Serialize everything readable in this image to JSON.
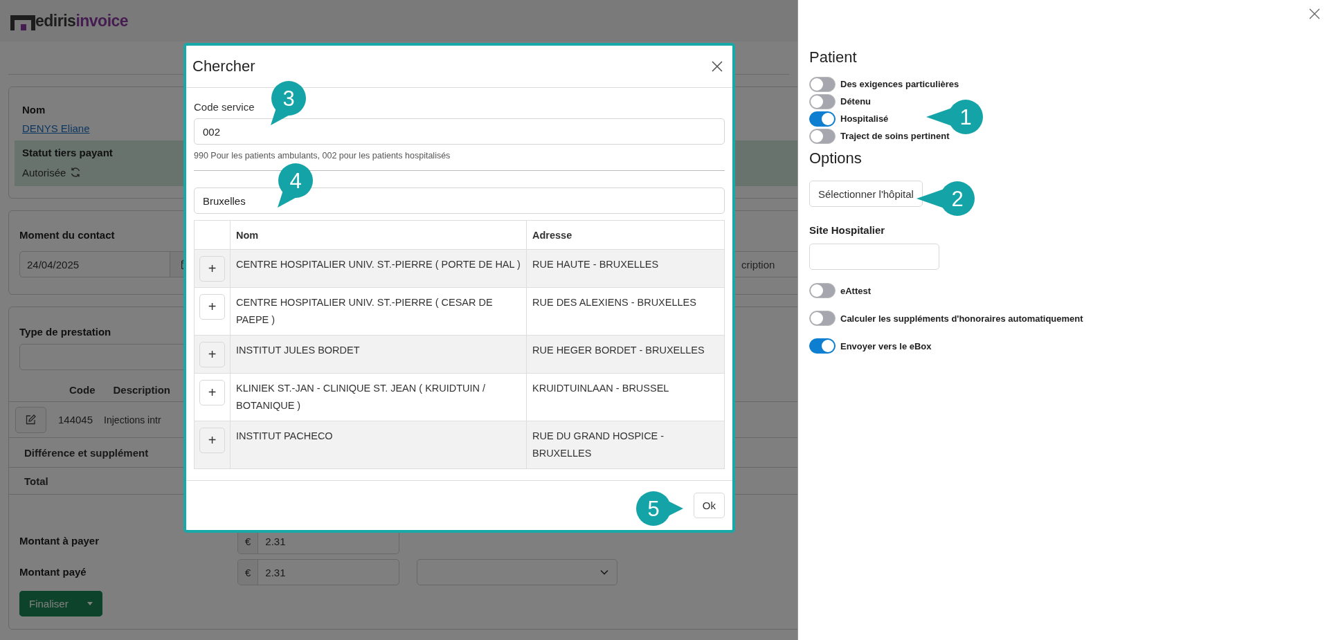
{
  "logo": {
    "brand": "ediris",
    "product": "invoice"
  },
  "patient_card": {
    "name_label": "Nom",
    "name": "DENYS Eliane",
    "status_label": "Statut tiers payant",
    "status": "Autorisée"
  },
  "contact_card": {
    "label": "Moment du contact",
    "date": "24/04/2025",
    "field_2_text": "cription"
  },
  "service_card": {
    "label": "Type de prestation",
    "columns": [
      "Code",
      "Description"
    ],
    "rows": [
      {
        "code": "144045",
        "description": "Injections intr"
      }
    ],
    "difference_label": "Différence et supplément",
    "total_label": "Total"
  },
  "payment": {
    "due_label": "Montant à payer",
    "due_currency": "€",
    "due_amount": "2.31",
    "paid_label": "Montant payé",
    "paid_currency": "€",
    "paid_amount": "2.31",
    "finalize_button": "Finaliser"
  },
  "modal": {
    "title": "Chercher",
    "service_code_label": "Code service",
    "service_code": "002",
    "hint": "990 Pour les patients ambulants, 002 pour les patients hospitalisés",
    "search": "Bruxelles",
    "columns": [
      "Nom",
      "Adresse"
    ],
    "rows": [
      {
        "name": "CENTRE HOSPITALIER UNIV. ST.-PIERRE ( PORTE DE HAL )",
        "address": "RUE HAUTE - BRUXELLES",
        "add": "+"
      },
      {
        "name": "CENTRE HOSPITALIER UNIV. ST.-PIERRE ( CESAR DE PAEPE )",
        "address": "RUE DES ALEXIENS - BRUXELLES",
        "add": "+"
      },
      {
        "name": "INSTITUT JULES BORDET",
        "address": "RUE HEGER BORDET - BRUXELLES",
        "add": "+"
      },
      {
        "name": "KLINIEK ST.-JAN - CLINIQUE ST. JEAN ( KRUIDTUIN / BOTANIQUE )",
        "address": "KRUIDTUINLAAN - BRUSSEL",
        "add": "+"
      },
      {
        "name": "INSTITUT PACHECO",
        "address": "RUE DU GRAND HOSPICE - BRUXELLES",
        "add": "+"
      }
    ],
    "ok_button": "Ok"
  },
  "side_panel": {
    "patient_heading": "Patient",
    "patient_toggles": [
      {
        "label": "Des exigences particulières",
        "on": false
      },
      {
        "label": "Détenu",
        "on": false
      },
      {
        "label": "Hospitalisé",
        "on": true
      },
      {
        "label": "Traject de soins pertinent",
        "on": false
      }
    ],
    "options_heading": "Options",
    "select_hospital_button": "Sélectionner l'hôpital",
    "site_label": "Site Hospitalier",
    "option_toggles": [
      {
        "label": "eAttest",
        "on": false
      },
      {
        "label": "Calculer les suppléments d'honoraires automatiquement",
        "on": false
      },
      {
        "label": "Envoyer vers le eBox",
        "on": true
      }
    ]
  },
  "callouts": [
    {
      "number": "1"
    },
    {
      "number": "2"
    },
    {
      "number": "3"
    },
    {
      "number": "4"
    },
    {
      "number": "5"
    }
  ]
}
